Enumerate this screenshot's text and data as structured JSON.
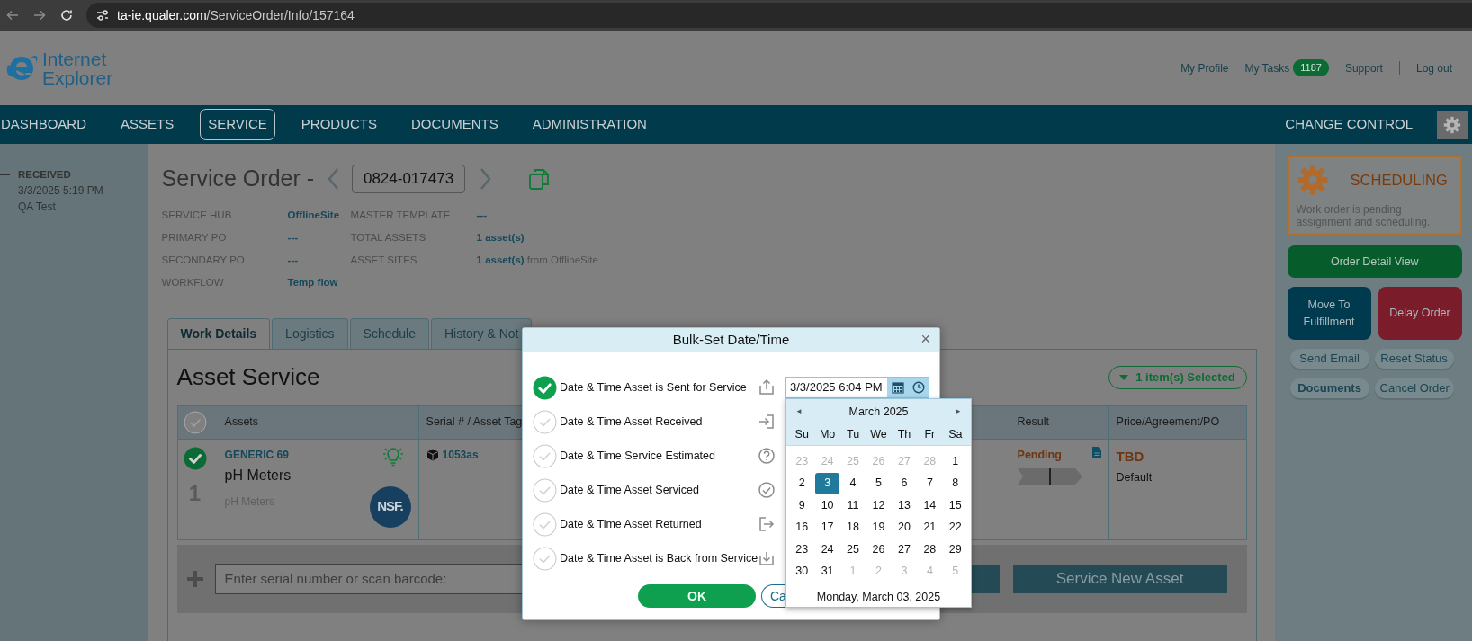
{
  "browser": {
    "url_host": "ta-ie.qualer.com",
    "url_path": "/ServiceOrder/Info/157164"
  },
  "header": {
    "logo_lines": [
      "Internet",
      "Explorer"
    ],
    "links": [
      {
        "label": "My Profile",
        "divider_before": false
      },
      {
        "label": "My Tasks",
        "badge": "1187",
        "divider_before": false
      },
      {
        "label": "Support",
        "divider_before": false
      },
      {
        "label": "Log out",
        "divider_before": true
      }
    ]
  },
  "nav": {
    "items": [
      {
        "label": "DASHBOARD",
        "selected": false
      },
      {
        "label": "ASSETS",
        "selected": false
      },
      {
        "label": "SERVICE",
        "selected": true
      },
      {
        "label": "PRODUCTS",
        "selected": false
      },
      {
        "label": "DOCUMENTS",
        "selected": false
      },
      {
        "label": "ADMINISTRATION",
        "selected": false
      }
    ],
    "right_label": "CHANGE CONTROL"
  },
  "timeline": [
    {
      "status": "RECEIVED",
      "date": "3/3/2025 5:19 PM",
      "user": "QA Test"
    }
  ],
  "order": {
    "title": "Service Order -",
    "number": "0824-017473",
    "fields": [
      {
        "label": "SERVICE HUB",
        "value": "OfflineSite"
      },
      {
        "label": "MASTER TEMPLATE",
        "value": "---"
      },
      {
        "label": "PRIMARY PO",
        "value": "---"
      },
      {
        "label": "TOTAL ASSETS",
        "value": "1 asset(s)"
      },
      {
        "label": "SECONDARY PO",
        "value": "---"
      },
      {
        "label": "ASSET SITES",
        "value": "1 asset(s)",
        "note": "from OfflineSite"
      },
      {
        "label": "WORKFLOW",
        "value": "Temp flow"
      }
    ]
  },
  "tabs": [
    {
      "label": "Work Details",
      "selected": true
    },
    {
      "label": "Logistics",
      "selected": false
    },
    {
      "label": "Schedule",
      "selected": false
    },
    {
      "label": "History & Not",
      "selected": false
    }
  ],
  "asset_service": {
    "title": "Asset Service",
    "selection_button": "1 item(s) Selected",
    "all_checked": false,
    "columns": [
      {
        "label": "Assets"
      },
      {
        "label": "Serial # / Asset Tag"
      },
      {
        "label": "Result"
      },
      {
        "label": "Price/Agreement/PO"
      }
    ],
    "rows": [
      {
        "checked": true,
        "index": "1",
        "code": "GENERIC 69",
        "name": "pH Meters",
        "category": "pH Meters",
        "cert": "NSF.",
        "serial": "1053as",
        "result": "Pending",
        "price": "TBD",
        "agreement": "Default"
      }
    ],
    "scan_placeholder": "Enter serial number or scan barcode:",
    "service_button": "Service New Asset"
  },
  "side": {
    "status": {
      "title": "SCHEDULING",
      "text": "Work order is pending assignment and scheduling."
    },
    "buttons": [
      {
        "label": "Order Detail View",
        "kind": "primary"
      },
      {
        "label": "Move To Fulfillment",
        "kind": "advance"
      },
      {
        "label": "Delay Order",
        "kind": "danger"
      },
      {
        "label": "Send Email",
        "kind": "pill"
      },
      {
        "label": "Reset Status",
        "kind": "pill"
      },
      {
        "label": "Documents",
        "kind": "pill-bold"
      },
      {
        "label": "Cancel Order",
        "kind": "pill"
      }
    ]
  },
  "modal": {
    "title": "Bulk-Set Date/Time",
    "close": "×",
    "rows": [
      {
        "label": "Date & Time Asset is Sent for Service",
        "checked": true,
        "value": "3/3/2025 6:04 PM"
      },
      {
        "label": "Date & Time Asset Received",
        "checked": false
      },
      {
        "label": "Date & Time Service Estimated",
        "checked": false
      },
      {
        "label": "Date & Time Asset Serviced",
        "checked": false
      },
      {
        "label": "Date & Time Asset Returned",
        "checked": false
      },
      {
        "label": "Date & Time Asset is Back from Service",
        "checked": false
      }
    ],
    "ok": "OK",
    "cancel": "Ca"
  },
  "calendar": {
    "prev": "◄",
    "month": "March 2025",
    "next": "►",
    "weekdays": [
      "Su",
      "Mo",
      "Tu",
      "We",
      "Th",
      "Fr",
      "Sa"
    ],
    "weeks": [
      [
        {
          "day": "23",
          "outside": true,
          "selected": false
        },
        {
          "day": "24",
          "outside": true,
          "selected": false
        },
        {
          "day": "25",
          "outside": true,
          "selected": false
        },
        {
          "day": "26",
          "outside": true,
          "selected": false
        },
        {
          "day": "27",
          "outside": true,
          "selected": false
        },
        {
          "day": "28",
          "outside": true,
          "selected": false
        },
        {
          "day": "1",
          "outside": false,
          "selected": false
        }
      ],
      [
        {
          "day": "2",
          "outside": false,
          "selected": false
        },
        {
          "day": "3",
          "outside": false,
          "selected": true
        },
        {
          "day": "4",
          "outside": false,
          "selected": false
        },
        {
          "day": "5",
          "outside": false,
          "selected": false
        },
        {
          "day": "6",
          "outside": false,
          "selected": false
        },
        {
          "day": "7",
          "outside": false,
          "selected": false
        },
        {
          "day": "8",
          "outside": false,
          "selected": false
        }
      ],
      [
        {
          "day": "9",
          "outside": false,
          "selected": false
        },
        {
          "day": "10",
          "outside": false,
          "selected": false
        },
        {
          "day": "11",
          "outside": false,
          "selected": false
        },
        {
          "day": "12",
          "outside": false,
          "selected": false
        },
        {
          "day": "13",
          "outside": false,
          "selected": false
        },
        {
          "day": "14",
          "outside": false,
          "selected": false
        },
        {
          "day": "15",
          "outside": false,
          "selected": false
        }
      ],
      [
        {
          "day": "16",
          "outside": false,
          "selected": false
        },
        {
          "day": "17",
          "outside": false,
          "selected": false
        },
        {
          "day": "18",
          "outside": false,
          "selected": false
        },
        {
          "day": "19",
          "outside": false,
          "selected": false
        },
        {
          "day": "20",
          "outside": false,
          "selected": false
        },
        {
          "day": "21",
          "outside": false,
          "selected": false
        },
        {
          "day": "22",
          "outside": false,
          "selected": false
        }
      ],
      [
        {
          "day": "23",
          "outside": false,
          "selected": false
        },
        {
          "day": "24",
          "outside": false,
          "selected": false
        },
        {
          "day": "25",
          "outside": false,
          "selected": false
        },
        {
          "day": "26",
          "outside": false,
          "selected": false
        },
        {
          "day": "27",
          "outside": false,
          "selected": false
        },
        {
          "day": "28",
          "outside": false,
          "selected": false
        },
        {
          "day": "29",
          "outside": false,
          "selected": false
        }
      ],
      [
        {
          "day": "30",
          "outside": false,
          "selected": false
        },
        {
          "day": "31",
          "outside": false,
          "selected": false
        },
        {
          "day": "1",
          "outside": true,
          "selected": false
        },
        {
          "day": "2",
          "outside": true,
          "selected": false
        },
        {
          "day": "3",
          "outside": true,
          "selected": false
        },
        {
          "day": "4",
          "outside": true,
          "selected": false
        },
        {
          "day": "5",
          "outside": true,
          "selected": false
        }
      ]
    ],
    "footer": "Monday, March 03, 2025"
  }
}
